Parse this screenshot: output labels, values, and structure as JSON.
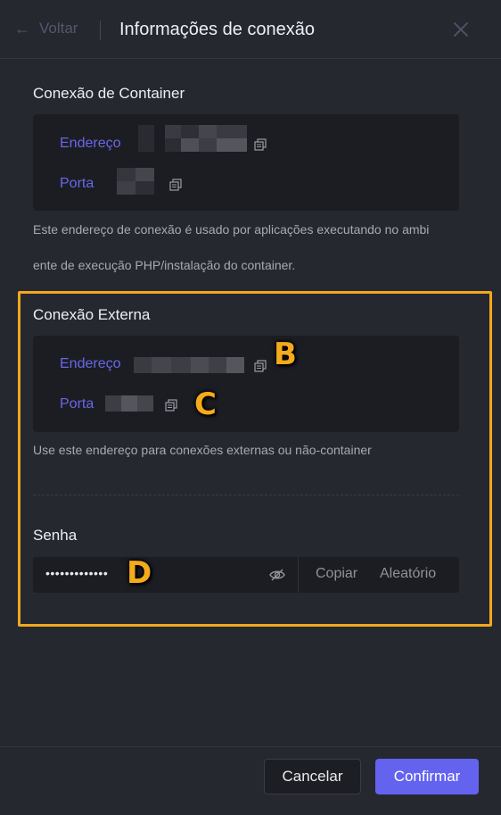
{
  "header": {
    "back_label": "Voltar",
    "title": "Informações de conexão",
    "back_icon": "arrow-left-icon",
    "close_icon": "close-icon"
  },
  "container_connection": {
    "title": "Conexão de Container",
    "address_label": "Endereço",
    "port_label": "Porta",
    "help_line1": "Este endereço de conexão é usado por aplicações executando no ambi",
    "help_line2": "ente de execução PHP/instalação do container."
  },
  "external_connection": {
    "title": "Conexão Externa",
    "address_label": "Endereço",
    "port_label": "Porta",
    "help": "Use este endereço para conexões externas ou não-container"
  },
  "password": {
    "title": "Senha",
    "value": "•••••••••••••",
    "copy_label": "Copiar",
    "random_label": "Aleatório",
    "visibility_icon": "eye-off-icon"
  },
  "callouts": {
    "b": "B",
    "c": "C",
    "d": "D"
  },
  "footer": {
    "cancel_label": "Cancelar",
    "confirm_label": "Confirmar"
  },
  "colors": {
    "accent": "#6363f0",
    "label_blue": "#6868e8",
    "highlight": "#f2a81d"
  }
}
